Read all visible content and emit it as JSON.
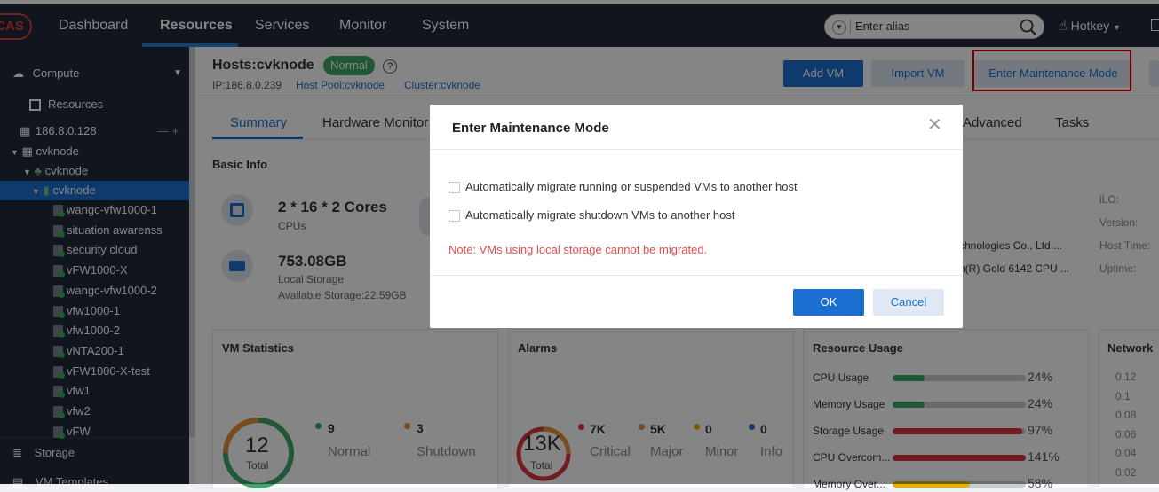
{
  "nav": {
    "logo": "CAS",
    "items": [
      "Dashboard",
      "Resources",
      "Services",
      "Monitor",
      "System"
    ],
    "search_placeholder": "Enter alias",
    "user": "Hotkey"
  },
  "sidebar": {
    "compute": "Compute",
    "resources": "Resources",
    "host_ip": "186.8.0.128",
    "host_ip_actions": "— +",
    "tree": [
      {
        "label": "cvknode",
        "level": 0
      },
      {
        "label": "cvknode",
        "level": 1
      },
      {
        "label": "cvknode",
        "level": 2,
        "selected": true
      }
    ],
    "vms": [
      "wangc-vfw1000-1",
      "situation awarenss",
      "security cloud",
      "vFW1000-X",
      "wangc-vfw1000-2",
      "vfw1000-1",
      "vfw1000-2",
      "vNTA200-1",
      "vFW1000-X-test",
      "vfw1",
      "vfw2",
      "vFW"
    ],
    "storage": "Storage",
    "vm_templates": "VM Templates"
  },
  "host": {
    "title": "Hosts:cvknode",
    "status": "Normal",
    "ip": "IP:186.8.0.239",
    "pool": "Host Pool:cvknode",
    "cluster": "Cluster:cvknode"
  },
  "actions": {
    "add_vm": "Add VM",
    "import_vm": "Import VM",
    "enter_maintenance": "Enter Maintenance Mode"
  },
  "tabs": [
    "Summary",
    "Hardware Monitor",
    "Advanced",
    "Tasks"
  ],
  "basic_info": {
    "heading": "Basic Info",
    "cpu_value": "2 * 16 * 2 Cores",
    "cpu_label": "CPUs",
    "storage_value": "753.08GB",
    "storage_label": "Local Storage",
    "storage_avail": "Available Storage:22.59GB",
    "vendor": "chnologies Co., Ltd....",
    "cpu_model": "n(R) Gold 6142 CPU ...",
    "ilo": "iLO:",
    "version": "Version:",
    "host_time": "Host Time:",
    "uptime": "Uptime:"
  },
  "vm_stats": {
    "heading": "VM Statistics",
    "total": "12",
    "total_label": "Total",
    "normal_count": "9",
    "normal_label": "Normal",
    "shutdown_count": "3",
    "shutdown_label": "Shutdown"
  },
  "alarms": {
    "heading": "Alarms",
    "total": "13K",
    "total_label": "Total",
    "critical": "7K",
    "critical_label": "Critical",
    "major": "5K",
    "major_label": "Major",
    "minor": "0",
    "minor_label": "Minor",
    "info": "0",
    "info_label": "Info"
  },
  "resource_usage": {
    "heading": "Resource Usage",
    "rows": [
      {
        "label": "CPU Usage",
        "value": "24%",
        "pct": 24,
        "color": "#3fa768"
      },
      {
        "label": "Memory Usage",
        "value": "24%",
        "pct": 24,
        "color": "#3fa768"
      },
      {
        "label": "Storage Usage",
        "value": "97%",
        "pct": 97,
        "color": "#d9363e"
      },
      {
        "label": "CPU Overcom...",
        "value": "141%",
        "pct": 100,
        "color": "#d9363e"
      },
      {
        "label": "Memory Over...",
        "value": "58%",
        "pct": 58,
        "color": "#e0b400"
      }
    ]
  },
  "network": {
    "heading": "Network",
    "ticks": [
      "0.12",
      "0.1",
      "0.08",
      "0.06",
      "0.04",
      "0.02"
    ]
  },
  "modal": {
    "title": "Enter Maintenance Mode",
    "option1": "Automatically migrate running or suspended VMs to another host",
    "option2": "Automatically migrate shutdown VMs to another host",
    "note": "Note: VMs using local storage cannot be migrated.",
    "ok": "OK",
    "cancel": "Cancel"
  },
  "colors": {
    "nav_bg": "#1f2a3a",
    "accent": "#1b6fd1",
    "normal_green": "#3fa768",
    "note_red": "#e0504e"
  }
}
